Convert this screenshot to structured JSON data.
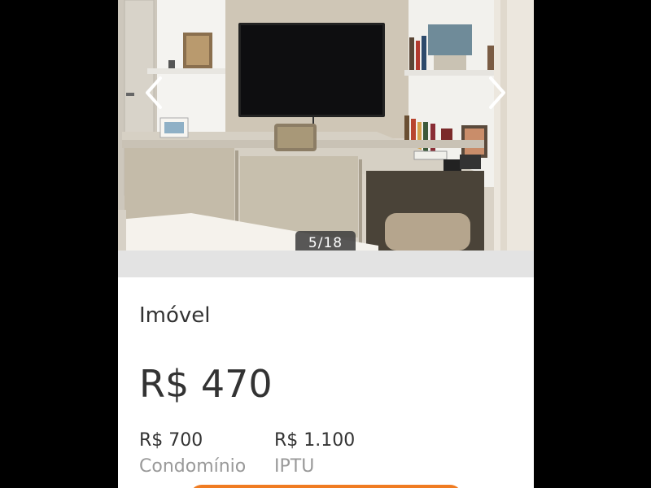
{
  "gallery": {
    "counter": "5/18",
    "prev_icon": "chevron-left-icon",
    "next_icon": "chevron-right-icon"
  },
  "listing": {
    "section_label": "Imóvel",
    "price": "R$ 470",
    "fees": [
      {
        "value": "R$ 700",
        "label": "Condomínio"
      },
      {
        "value": "R$ 1.100",
        "label": "IPTU"
      }
    ]
  },
  "colors": {
    "accent": "#f07c22",
    "text": "#333333",
    "muted": "#999999"
  }
}
